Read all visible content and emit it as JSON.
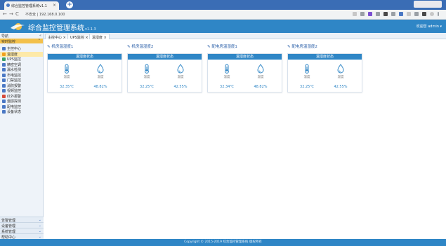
{
  "browser": {
    "tab_title": "综合监控管理系统v1.1",
    "tab_close": "×",
    "new_tab": "+",
    "url": "不安全 | 192.168.0.100",
    "nav": {
      "back": "←",
      "forward": "→",
      "reload": "C"
    }
  },
  "app": {
    "title": "综合监控管理系统",
    "version": "v1.1.3",
    "user": "欢迎您 admin ▾"
  },
  "sidebar": {
    "top_label": "导航",
    "top_ctrl": "«",
    "group_label": "实时监控",
    "group_arrow": "⌃",
    "items": [
      {
        "label": "主控中心",
        "color": "#4a78c4"
      },
      {
        "label": "温湿度",
        "color": "#f0a020",
        "active": true
      },
      {
        "label": "UPS监控",
        "color": "#3aa06a"
      },
      {
        "label": "精密空调",
        "color": "#4a78c4"
      },
      {
        "label": "漏水检测",
        "color": "#4a78c4"
      },
      {
        "label": "市电监控",
        "color": "#4a78c4"
      },
      {
        "label": "门禁监控",
        "color": "#4a78c4"
      },
      {
        "label": "消防报警",
        "color": "#4a78c4"
      },
      {
        "label": "视频监控",
        "color": "#4a78c4"
      },
      {
        "label": "红外报警",
        "color": "#d64a3a"
      },
      {
        "label": "烟感探测",
        "color": "#4a78c4"
      },
      {
        "label": "配电监控",
        "color": "#4a78c4"
      },
      {
        "label": "设备状态",
        "color": "#4a78c4"
      }
    ],
    "bottom_groups": [
      {
        "label": "告警管理",
        "arrow": "⌄"
      },
      {
        "label": "设备管理",
        "arrow": "⌄"
      },
      {
        "label": "系统管理",
        "arrow": "⌄"
      },
      {
        "label": "帮助中心",
        "arrow": "⌄"
      }
    ]
  },
  "content_tabs": [
    "主控中心 ×",
    "UPS监控 ×",
    "温湿度 ×"
  ],
  "panels": [
    {
      "title": "✎ 机房温湿度1",
      "header": "温湿度状态",
      "temp_label": "温度",
      "hum_label": "湿度",
      "temp": "32.35℃",
      "hum": "48.82%"
    },
    {
      "title": "✎ 机房温湿度2",
      "header": "温湿度状态",
      "temp_label": "温度",
      "hum_label": "湿度",
      "temp": "32.25℃",
      "hum": "42.55%"
    },
    {
      "title": "✎ 配电房温湿度1",
      "header": "温湿度状态",
      "temp_label": "温度",
      "hum_label": "湿度",
      "temp": "32.34℃",
      "hum": "48.82%"
    },
    {
      "title": "✎ 配电房温湿度2",
      "header": "温湿度状态",
      "temp_label": "温度",
      "hum_label": "湿度",
      "temp": "32.25℃",
      "hum": "42.55%"
    }
  ],
  "footer": "Copyright © 2015-2019 综合监控管理系统 版权所有",
  "colors": {
    "header": "#2f86c6",
    "accent": "#f3c04a",
    "tabbar": "#3a6db5"
  }
}
